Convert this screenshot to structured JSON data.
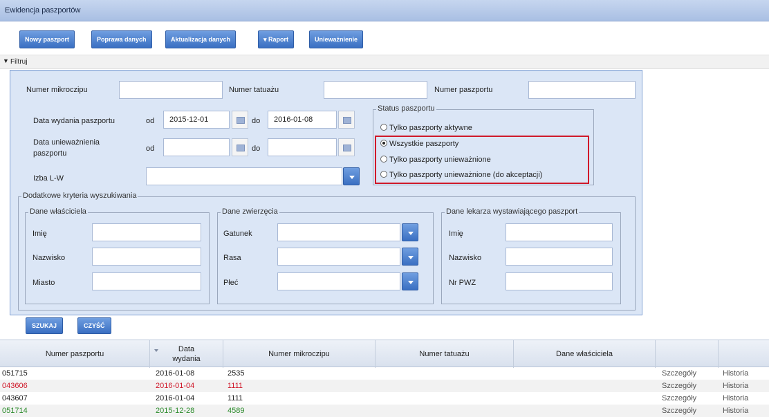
{
  "app": {
    "title": "Ewidencja paszportów"
  },
  "toolbar": {
    "new_passport": "Nowy paszport",
    "correct_data": "Poprawa danych",
    "update_data": "Aktualizacja danych",
    "report": "▾ Raport",
    "invalidation": "Unieważnienie"
  },
  "filter": {
    "toggle_label": "Filtruj",
    "microchip_label": "Numer mikroczipu",
    "microchip_value": "",
    "tattoo_label": "Numer tatuażu",
    "tattoo_value": "",
    "passport_label": "Numer paszportu",
    "passport_value": "",
    "issue_date_label": "Data wydania paszportu",
    "from_label": "od",
    "to_label": "do",
    "issue_from": "2015-12-01",
    "issue_to": "2016-01-08",
    "invalid_date_label_1": "Data unieważnienia",
    "invalid_date_label_2": "paszportu",
    "invalid_from": "",
    "invalid_to": "",
    "chamber_label": "Izba L-W",
    "chamber_value": "",
    "status": {
      "legend": "Status paszportu",
      "options": [
        "Tylko paszporty aktywne",
        "Wszystkie paszporty",
        "Tylko paszporty unieważnione",
        "Tylko paszporty unieważnione (do akceptacji)"
      ],
      "selected": "Wszystkie paszporty"
    },
    "extra": {
      "legend": "Dodatkowe kryteria wyszukiwania",
      "owner": {
        "legend": "Dane właściciela",
        "first_name": "Imię",
        "last_name": "Nazwisko",
        "city": "Miasto"
      },
      "animal": {
        "legend": "Dane zwierzęcia",
        "species": "Gatunek",
        "breed": "Rasa",
        "sex": "Płeć"
      },
      "vet": {
        "legend": "Dane lekarza wystawiającego paszport",
        "first_name": "Imię",
        "last_name": "Nazwisko",
        "pwz": "Nr PWZ"
      }
    },
    "search_button": "SZUKAJ",
    "clear_button": "CZYŚĆ"
  },
  "table": {
    "headers": {
      "passport": "Numer paszportu",
      "issue_date_1": "Data",
      "issue_date_2": "wydania",
      "microchip": "Numer mikroczipu",
      "tattoo": "Numer tatuażu",
      "owner": "Dane właściciela"
    },
    "rows": [
      {
        "passport": "051715",
        "date": "2016-01-08",
        "chip": "2535",
        "details": "Szczegóły",
        "history": "Historia",
        "color": "black"
      },
      {
        "passport": "043606",
        "date": "2016-01-04",
        "chip": "1111",
        "details": "Szczegóły",
        "history": "Historia",
        "color": "red"
      },
      {
        "passport": "043607",
        "date": "2016-01-04",
        "chip": "1111",
        "details": "Szczegóły",
        "history": "Historia",
        "color": "black"
      },
      {
        "passport": "051714",
        "date": "2015-12-28",
        "chip": "4589",
        "details": "Szczegóły",
        "history": "Historia",
        "color": "green"
      }
    ]
  }
}
